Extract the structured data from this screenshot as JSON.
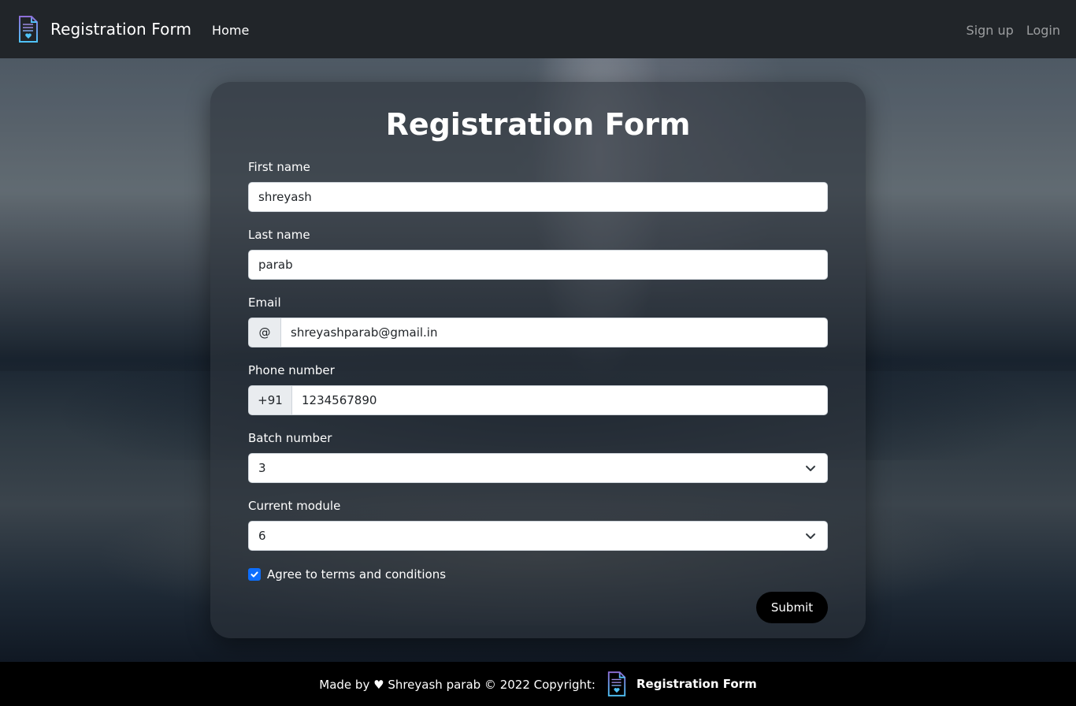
{
  "navbar": {
    "brand_icon": "document-heart-icon",
    "brand": "Registration Form",
    "home": "Home",
    "signup": "Sign up",
    "login": "Login"
  },
  "form": {
    "title": "Registration Form",
    "first_name": {
      "label": "First name",
      "value": "shreyash"
    },
    "last_name": {
      "label": "Last name",
      "value": "parab"
    },
    "email": {
      "label": "Email",
      "prefix": "@",
      "value": "shreyashparab@gmail.in"
    },
    "phone": {
      "label": "Phone number",
      "prefix": "+91",
      "value": "1234567890"
    },
    "batch": {
      "label": "Batch number",
      "selected": "3"
    },
    "module": {
      "label": "Current module",
      "selected": "6"
    },
    "terms": {
      "label": "Agree to terms and conditions",
      "checked": true
    },
    "submit": "Submit"
  },
  "footer": {
    "text": "Made by ♥ Shreyash parab © 2022 Copyright:",
    "brand_icon": "document-heart-icon",
    "brand": "Registration Form"
  },
  "colors": {
    "navbar_bg": "#212529",
    "footer_bg": "#000000",
    "checkbox_accent": "#0d6efd"
  }
}
